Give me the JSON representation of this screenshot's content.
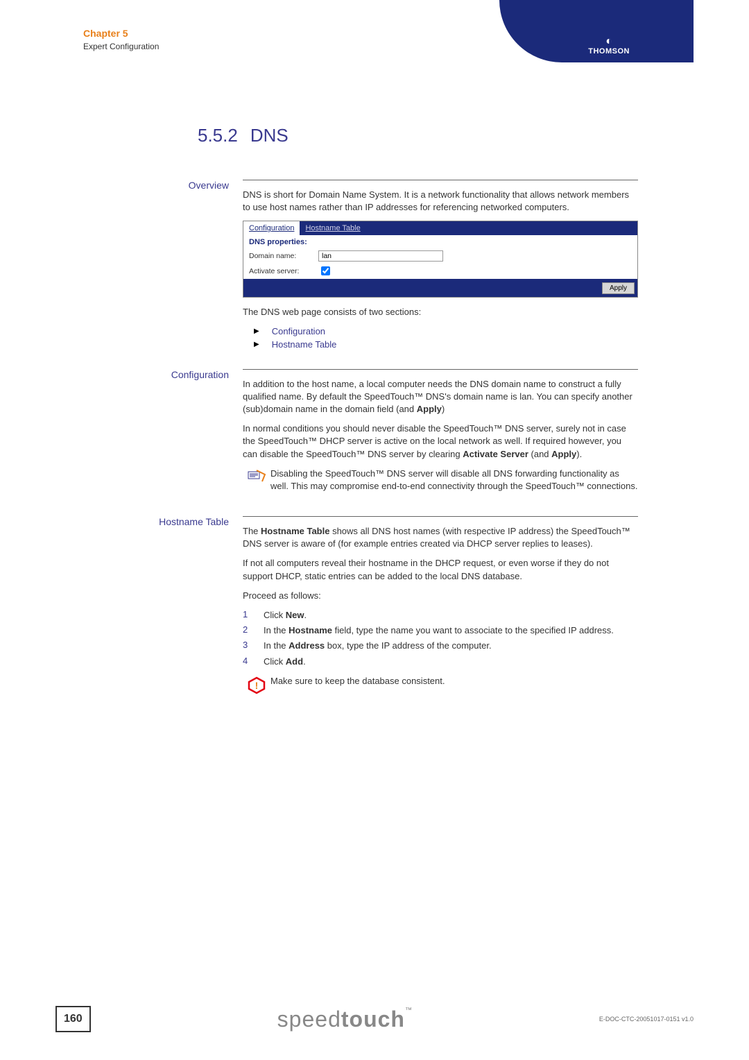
{
  "header": {
    "chapter": "Chapter 5",
    "subtitle": "Expert Configuration",
    "brand": "THOMSON"
  },
  "title": {
    "number": "5.5.2",
    "text": "DNS"
  },
  "overview": {
    "label": "Overview",
    "intro": "DNS is short for Domain Name System. It is a network functionality that allows network members to use host names rather than IP addresses for referencing networked computers.",
    "screenshot": {
      "tabs": {
        "active": "Configuration",
        "inactive": "Hostname Table"
      },
      "section_header": "DNS properties:",
      "domain_name": {
        "label": "Domain name:",
        "value": "lan"
      },
      "activate": {
        "label": "Activate server:",
        "checked": true
      },
      "apply": "Apply"
    },
    "sections_text": "The DNS web page consists of two sections:",
    "bullets": [
      "Configuration",
      "Hostname Table"
    ]
  },
  "configuration": {
    "label": "Configuration",
    "p1_prefix": "In addition to the host name, a local computer needs the DNS domain name to construct a fully qualified name. By default the SpeedTouch™ DNS's domain name is lan. You can specify another (sub)domain name in the domain field (and ",
    "p1_bold": "Apply",
    "p1_suffix": ")",
    "p2_prefix": "In normal conditions you should never disable the SpeedTouch™ DNS server, surely not in case the SpeedTouch™ DHCP server is active on the local network as well. If required however, you can disable the SpeedTouch™ DNS server by clearing ",
    "p2_bold1": "Activate Server",
    "p2_mid": " (and ",
    "p2_bold2": "Apply",
    "p2_suffix": ").",
    "note": "Disabling the SpeedTouch™ DNS server will disable all DNS forwarding functionality as well. This may compromise end-to-end connectivity through the SpeedTouch™ connections."
  },
  "hostname_table": {
    "label": "Hostname Table",
    "p1_prefix": "The ",
    "p1_bold": "Hostname Table",
    "p1_suffix": " shows all DNS host names (with respective IP address) the SpeedTouch™ DNS server is aware of (for example entries created via DHCP server replies to leases).",
    "p2": "If not all computers reveal their hostname in the DHCP request, or even worse if they do not support DHCP, static entries can be added to the local DNS database.",
    "proceed": "Proceed as follows:",
    "steps": {
      "s1": {
        "num": "1",
        "pre": "Click ",
        "b": "New",
        "suf": "."
      },
      "s2": {
        "num": "2",
        "pre": "In the ",
        "b": "Hostname",
        "suf": " field, type the name you want to associate to the specified IP address."
      },
      "s3": {
        "num": "3",
        "pre": "In the ",
        "b": "Address",
        "suf": " box, type the IP address of the computer."
      },
      "s4": {
        "num": "4",
        "pre": "Click ",
        "b": "Add",
        "suf": "."
      }
    },
    "caution": "Make sure to keep the database consistent."
  },
  "footer": {
    "page": "160",
    "doc_id": "E-DOC-CTC-20051017-0151 v1.0"
  }
}
